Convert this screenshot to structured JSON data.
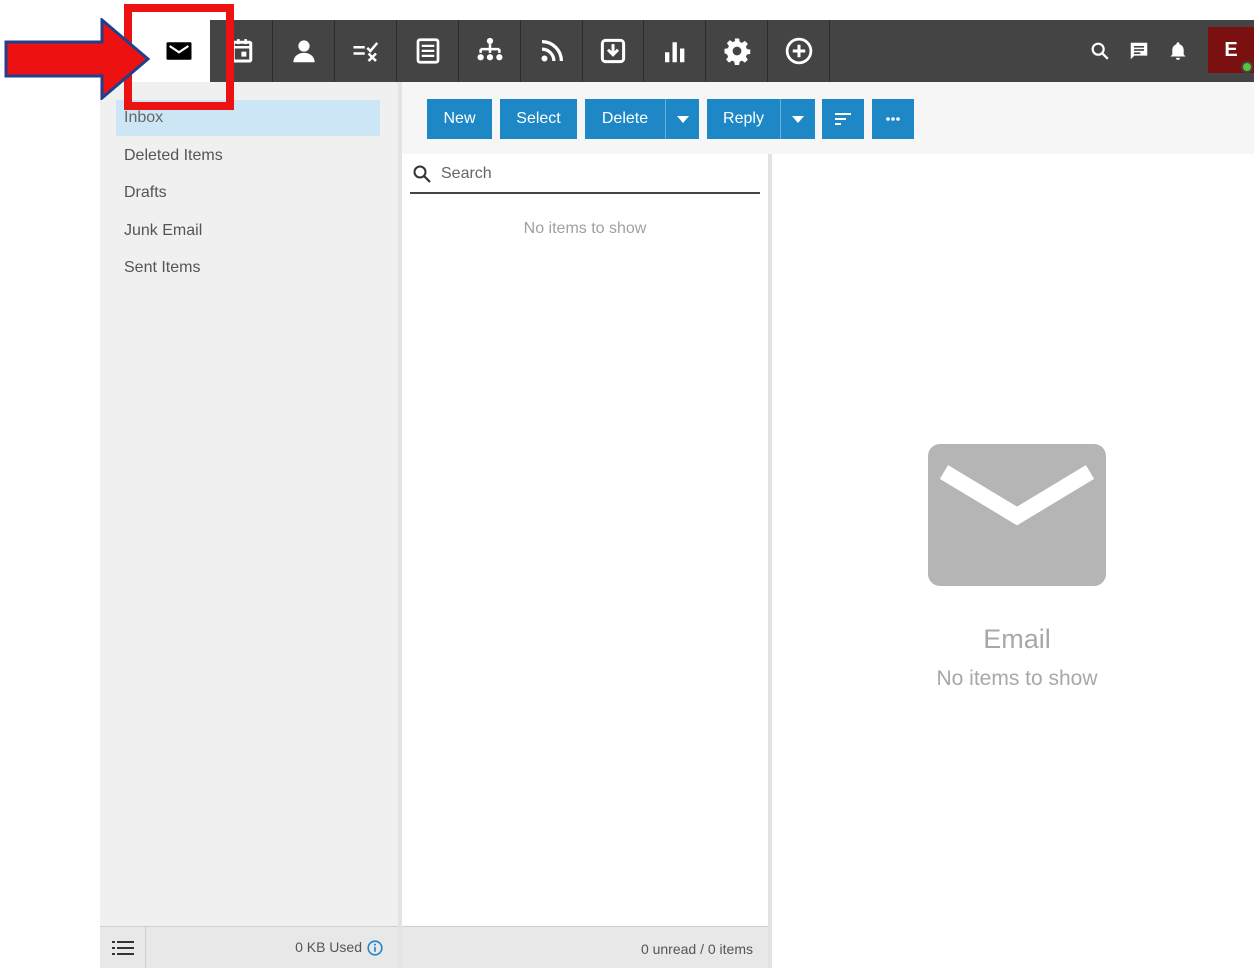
{
  "nav": {
    "tabs": [
      {
        "icon": "mail-icon",
        "active": true
      },
      {
        "icon": "calendar-icon"
      },
      {
        "icon": "contacts-icon"
      },
      {
        "icon": "tasks-icon"
      },
      {
        "icon": "notes-icon"
      },
      {
        "icon": "org-chart-icon"
      },
      {
        "icon": "rss-feed-icon"
      },
      {
        "icon": "download-icon"
      },
      {
        "icon": "reports-icon"
      },
      {
        "icon": "settings-gear-icon"
      },
      {
        "icon": "add-circle-icon"
      }
    ],
    "right_icons": [
      "search-icon",
      "chat-icon",
      "notification-bell-icon"
    ],
    "avatar_initial": "E",
    "presence_color": "#5fbf3f"
  },
  "sidebar": {
    "folders": [
      {
        "label": "Inbox",
        "selected": true
      },
      {
        "label": "Deleted Items"
      },
      {
        "label": "Drafts"
      },
      {
        "label": "Junk Email"
      },
      {
        "label": "Sent Items"
      }
    ],
    "storage_used": "0 KB Used"
  },
  "toolbar": {
    "new_label": "New",
    "select_label": "Select",
    "delete_label": "Delete",
    "reply_label": "Reply"
  },
  "message_list": {
    "search_placeholder": "Search",
    "empty_text": "No items to show",
    "count_text": "0 unread / 0 items"
  },
  "reading_pane": {
    "title": "Email",
    "subtitle": "No items to show"
  },
  "colors": {
    "topbar": "#444444",
    "accent": "#1e88c7",
    "selected_folder": "#cde6f5",
    "annotation": "#ee1111",
    "avatar": "#7a1010"
  }
}
